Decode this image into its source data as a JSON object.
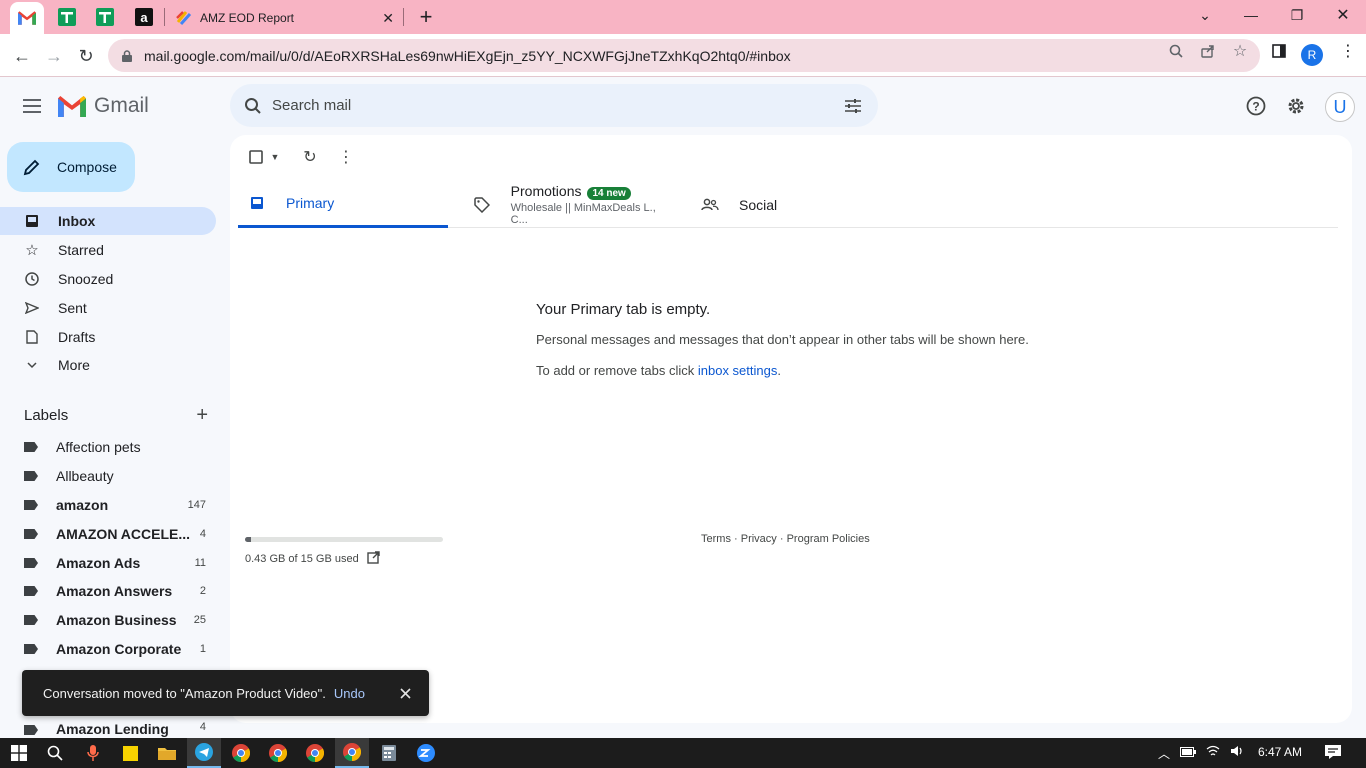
{
  "browser": {
    "pinned_tabs": [
      {
        "name": "gmail-favicon"
      },
      {
        "name": "sheets-favicon"
      },
      {
        "name": "sheets-favicon"
      },
      {
        "name": "amazon-favicon",
        "glyph": "a"
      }
    ],
    "active_tab_title": "AMZ EOD Report",
    "url": "mail.google.com/mail/u/0/d/AEoRXRSHaLes69nwHiEXgEjn_z5YY_NCXWFGjJneTZxhKqO2htq0/#inbox",
    "profile_initial": "R"
  },
  "gmail": {
    "logo_text": "Gmail",
    "search_placeholder": "Search mail",
    "avatar_initial": "U",
    "compose_label": "Compose",
    "nav": [
      {
        "label": "Inbox",
        "icon": "inbox-icon",
        "active": true
      },
      {
        "label": "Starred",
        "icon": "star-icon"
      },
      {
        "label": "Snoozed",
        "icon": "clock-icon"
      },
      {
        "label": "Sent",
        "icon": "send-icon"
      },
      {
        "label": "Drafts",
        "icon": "draft-icon"
      },
      {
        "label": "More",
        "icon": "chevron-down-icon"
      }
    ],
    "labels_title": "Labels",
    "labels": [
      {
        "label": "Affection pets",
        "count": "",
        "bold": false
      },
      {
        "label": "Allbeauty",
        "count": "",
        "bold": false
      },
      {
        "label": "amazon",
        "count": "147",
        "bold": true
      },
      {
        "label": "AMAZON ACCELE...",
        "count": "4",
        "bold": true
      },
      {
        "label": "Amazon Ads",
        "count": "11",
        "bold": true
      },
      {
        "label": "Amazon Answers",
        "count": "2",
        "bold": true
      },
      {
        "label": "Amazon Business",
        "count": "25",
        "bold": true
      },
      {
        "label": "Amazon Corporate",
        "count": "1",
        "bold": true
      },
      {
        "label": "Amazon Lending",
        "count": "4",
        "bold": true
      }
    ],
    "tabs": {
      "primary": "Primary",
      "promotions": "Promotions",
      "promotions_badge": "14 new",
      "promotions_snippet": "Wholesale || MinMaxDeals L., C...",
      "social": "Social"
    },
    "empty_title": "Your Primary tab is empty.",
    "empty_line1": "Personal messages and messages that don’t appear in other tabs will be shown here.",
    "empty_line2_prefix": "To add or remove tabs click ",
    "empty_line2_link": "inbox settings",
    "empty_line2_suffix": ".",
    "storage_text": "0.43 GB of 15 GB used",
    "storage_fraction": 0.029,
    "footer": {
      "terms": "Terms",
      "sep": " · ",
      "privacy": "Privacy",
      "policies": "Program Policies"
    }
  },
  "snackbar": {
    "message": "Conversation moved to \"Amazon Product Video\".",
    "undo": "Undo"
  },
  "taskbar": {
    "time": "6:47 AM"
  },
  "colors": {
    "tabstrip": "#f8b4c4",
    "accent": "#0b57d0",
    "compose": "#c2e7ff",
    "badge": "#188038"
  }
}
